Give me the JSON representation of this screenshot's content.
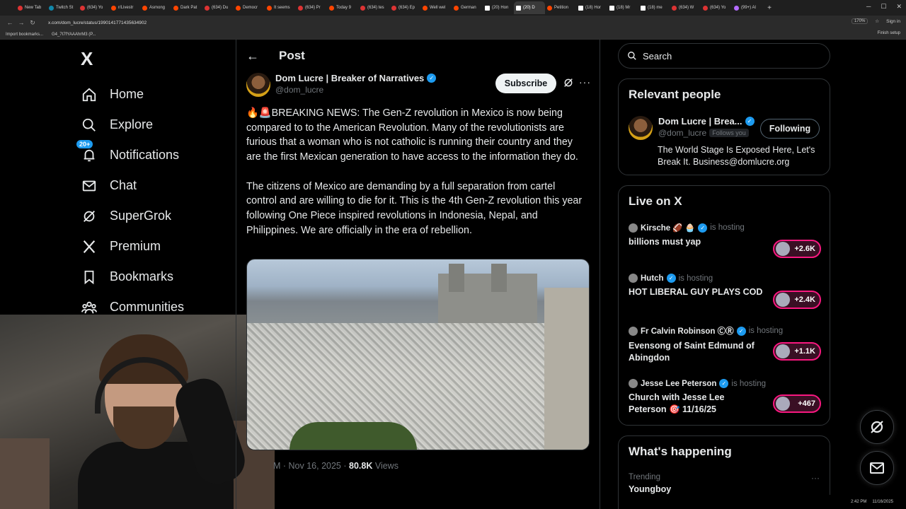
{
  "browser": {
    "tabs": [
      {
        "label": "New Tab",
        "icon": "chrome-icon"
      },
      {
        "label": "Twitch St",
        "icon": "twitch-icon"
      },
      {
        "label": "(634) Yo",
        "icon": "youtube-icon"
      },
      {
        "label": "r/Livestr",
        "icon": "reddit-icon"
      },
      {
        "label": "Asmong",
        "icon": "reddit-icon"
      },
      {
        "label": "Dark Pat",
        "icon": "reddit-icon"
      },
      {
        "label": "(634) Du",
        "icon": "youtube-icon"
      },
      {
        "label": "Democr",
        "icon": "reddit-icon"
      },
      {
        "label": "It seems",
        "icon": "reddit-icon"
      },
      {
        "label": "(634) Pr",
        "icon": "youtube-icon"
      },
      {
        "label": "Today 9",
        "icon": "reddit-icon"
      },
      {
        "label": "(634) tes",
        "icon": "youtube-icon"
      },
      {
        "label": "(634) Ep",
        "icon": "youtube-icon"
      },
      {
        "label": "Well wel",
        "icon": "reddit-icon"
      },
      {
        "label": "German",
        "icon": "reddit-icon"
      },
      {
        "label": "(20) Hon",
        "icon": "x-icon"
      },
      {
        "label": "(20) D",
        "icon": "x-icon",
        "active": true
      },
      {
        "label": "Petition",
        "icon": "reddit-icon"
      },
      {
        "label": "(18) Hor",
        "icon": "x-icon"
      },
      {
        "label": "(18) Mr",
        "icon": "x-icon"
      },
      {
        "label": "(18) me",
        "icon": "x-icon"
      },
      {
        "label": "(634) W",
        "icon": "youtube-icon"
      },
      {
        "label": "(634) Yo",
        "icon": "youtube-icon"
      },
      {
        "label": "(99+) Al",
        "icon": "proton-icon"
      }
    ],
    "url": "x.com/dom_lucre/status/1990141771435634902",
    "zoom": "170%",
    "sign_in": "Sign in",
    "bookmarks": [
      "Import bookmarks...",
      "G4_7t7fYAAAhrM3 (P..."
    ],
    "finish_setup": "Finish setup"
  },
  "sidebar": {
    "logo": "X",
    "items": [
      {
        "label": "Home",
        "icon": "home-icon"
      },
      {
        "label": "Explore",
        "icon": "search-icon"
      },
      {
        "label": "Notifications",
        "icon": "bell-icon",
        "badge": "20+"
      },
      {
        "label": "Chat",
        "icon": "mail-icon"
      },
      {
        "label": "SuperGrok",
        "icon": "grok-icon"
      },
      {
        "label": "Premium",
        "icon": "x-icon"
      },
      {
        "label": "Bookmarks",
        "icon": "bookmark-icon"
      },
      {
        "label": "Communities",
        "icon": "people-icon"
      }
    ]
  },
  "post": {
    "header_title": "Post",
    "author_name": "Dom Lucre | Breaker of Narratives",
    "author_handle": "@dom_lucre",
    "subscribe_label": "Subscribe",
    "paragraphs": [
      "🔥🚨BREAKING NEWS: The Gen-Z revolution in Mexico is now being compared to to the American Revolution. Many of the revolutionists are furious that a woman who is not catholic is running their country and they are the first Mexican generation to have access to the information they do.",
      "The citizens of Mexico are demanding by a full  separation from cartel control and are willing to die for it. This is the 4th Gen-Z revolution this year following  One Piece inspired revolutions in Indonesia, Nepal, and Philippines. We are officially in the era of rebellion."
    ],
    "meta_time": "M · Nov 16, 2025 · ",
    "views_count": "80.8K",
    "views_label": " Views"
  },
  "right": {
    "search_placeholder": "Search",
    "relevant_title": "Relevant people",
    "relevant_name": "Dom Lucre | Brea...",
    "relevant_handle": "@dom_lucre",
    "follows_you": "Follows you",
    "following_label": "Following",
    "relevant_bio": "The World Stage Is Exposed Here, Let's Break It. Business@domlucre.org",
    "live_title": "Live on X",
    "live_items": [
      {
        "host": "Kirsche 🏈 🧁",
        "hosting": "is hosting",
        "title": "billions must yap",
        "count": "+2.6K"
      },
      {
        "host": "Hutch",
        "hosting": "is hosting",
        "title": "HOT LIBERAL GUY PLAYS COD",
        "count": "+2.4K"
      },
      {
        "host": "Fr Calvin Robinson ⒸⓇ",
        "hosting": "is hosting",
        "title": "Evensong of Saint Edmund of Abingdon",
        "count": "+1.1K"
      },
      {
        "host": "Jesse Lee Peterson",
        "hosting": "is hosting",
        "title": "Church with Jesse Lee Peterson 🎯 11/16/25",
        "count": "+467"
      }
    ],
    "happening_title": "What's happening",
    "trending_label": "Trending",
    "trend_name": "Youngboy",
    "trend_more": "···"
  },
  "taskbar": {
    "time": "2:42 PM",
    "date": "11/16/2025"
  },
  "colors": {
    "accent": "#1d9bf0",
    "live": "#f91880",
    "background": "#000000"
  }
}
